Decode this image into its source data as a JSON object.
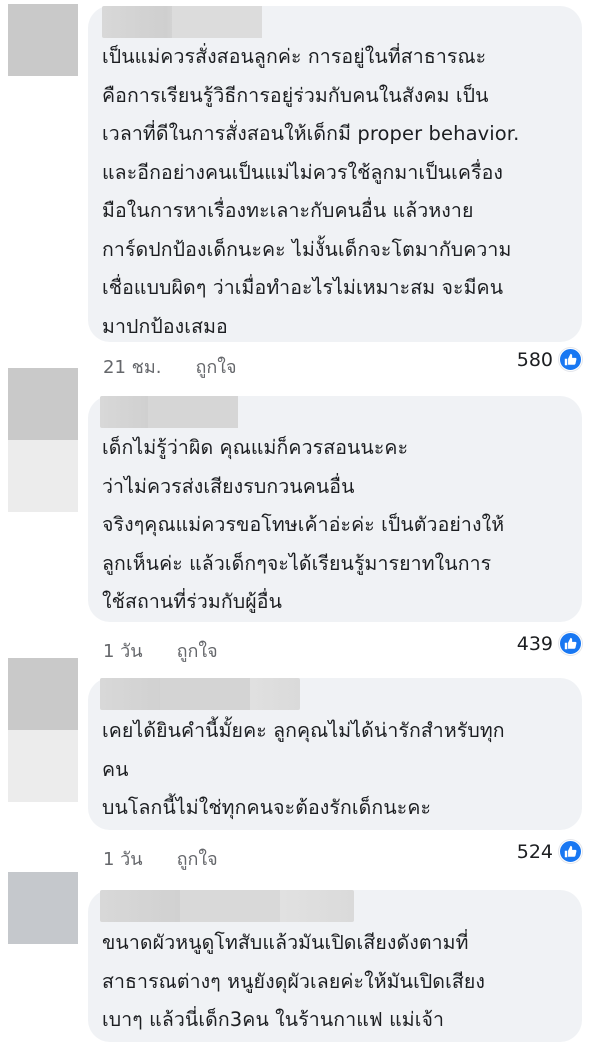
{
  "colors": {
    "bubble": "#f0f2f5",
    "meta": "#65676b",
    "like_blue": "#1877f2"
  },
  "comments": [
    {
      "author": "",
      "text": "เป็นแม่ควรสั่งสอนลูกค่ะ การอยู่ในที่สาธารณะ\nคือการเรียนรู้วิธีการอยู่ร่วมกับคนในสังคม เป็น\nเวลาที่ดีในการสั่งสอนให้เด็กมี proper behavior.\nและอีกอย่างคนเป็นแม่ไม่ควรใช้ลูกมาเป็นเครื่อง\nมือในการหาเรื่องทะเลาะกับคนอื่น แล้วหงาย\nการ์ดปกป้องเด็กนะคะ ไม่งั้นเด็กจะโตมากับความ\nเชื่อแบบผิดๆ ว่าเมื่อทำอะไรไม่เหมาะสม จะมีคน\nมาปกป้องเสมอ",
      "time": "21 ชม.",
      "like_label": "ถูกใจ",
      "reaction_count": "580",
      "reaction_icon": "thumbs-up-icon"
    },
    {
      "author": "",
      "text": "เด็กไม่รู้ว่าผิด คุณแม่ก็ควรสอนนะคะ\nว่าไม่ควรส่งเสียงรบกวนคนอื่น\nจริงๆคุณแม่ควรขอโทษเค้าอ่ะค่ะ เป็นตัวอย่างให้\nลูกเห็นค่ะ แล้วเด็กๆจะได้เรียนรู้มารยาทในการ\nใช้สถานที่ร่วมกับผู้อื่น",
      "time": "1 วัน",
      "like_label": "ถูกใจ",
      "reaction_count": "439",
      "reaction_icon": "thumbs-up-icon"
    },
    {
      "author": "",
      "text": "เคยได้ยินคำนี้มั้ยคะ ลูกคุณไม่ได้น่ารักสำหรับทุก\nคน\nบนโลกนี้ไม่ใช่ทุกคนจะต้องรักเด็กนะคะ",
      "time": "1 วัน",
      "like_label": "ถูกใจ",
      "reaction_count": "524",
      "reaction_icon": "thumbs-up-icon"
    },
    {
      "author": "",
      "text": "ขนาดผัวหนูดูโทสับแล้วมันเปิดเสียงดังตามที่\nสาธารณต่างๆ หนูยังดุผัวเลยค่ะให้มันเปิดเสียง\nเบาๆ แล้วนี่เด็ก3คน ในร้านกาแฟ แม่เจ้า"
    }
  ]
}
